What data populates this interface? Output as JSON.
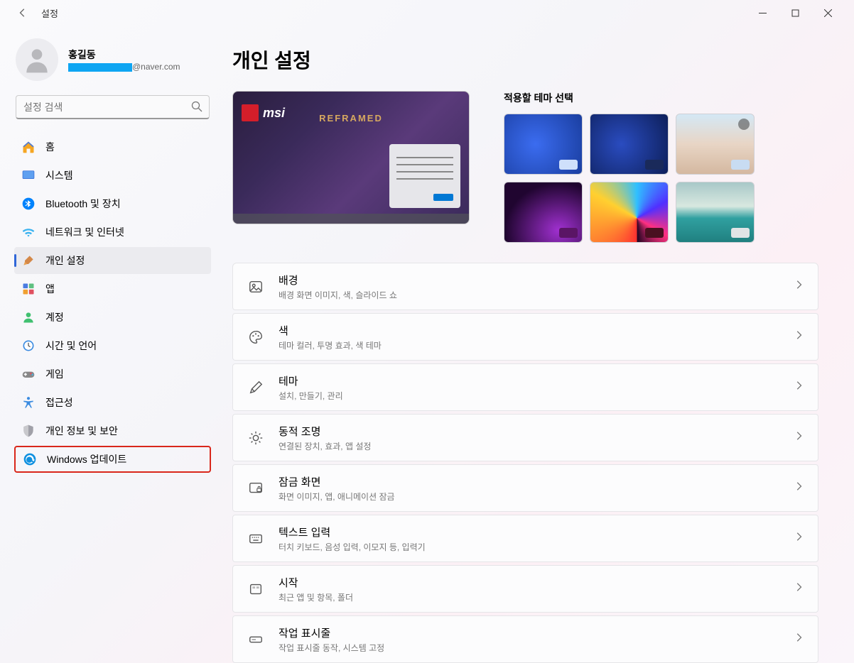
{
  "window": {
    "title": "설정"
  },
  "user": {
    "name": "홍길동",
    "email_domain": "@naver.com"
  },
  "search": {
    "placeholder": "설정 검색"
  },
  "nav": [
    {
      "key": "home",
      "label": "홈",
      "icon": "home"
    },
    {
      "key": "system",
      "label": "시스템",
      "icon": "system"
    },
    {
      "key": "bluetooth",
      "label": "Bluetooth 및 장치",
      "icon": "bluetooth"
    },
    {
      "key": "network",
      "label": "네트워크 및 인터넷",
      "icon": "wifi"
    },
    {
      "key": "personalization",
      "label": "개인 설정",
      "icon": "brush",
      "active": true
    },
    {
      "key": "apps",
      "label": "앱",
      "icon": "apps"
    },
    {
      "key": "accounts",
      "label": "계정",
      "icon": "user"
    },
    {
      "key": "time",
      "label": "시간 및 언어",
      "icon": "clock"
    },
    {
      "key": "gaming",
      "label": "게임",
      "icon": "gamepad"
    },
    {
      "key": "accessibility",
      "label": "접근성",
      "icon": "accessibility"
    },
    {
      "key": "privacy",
      "label": "개인 정보 및 보안",
      "icon": "shield"
    },
    {
      "key": "update",
      "label": "Windows 업데이트",
      "icon": "update",
      "highlighted": true
    }
  ],
  "page": {
    "title": "개인 설정"
  },
  "desktop_preview": {
    "brand": "msi",
    "caption": "REFRAMED"
  },
  "theme_picker": {
    "label": "적용할 테마 선택"
  },
  "settings_items": [
    {
      "key": "background",
      "title": "배경",
      "sub": "배경 화면 이미지, 색, 슬라이드 쇼",
      "icon": "image"
    },
    {
      "key": "colors",
      "title": "색",
      "sub": "테마 컬러, 투명 효과, 색 테마",
      "icon": "palette"
    },
    {
      "key": "themes",
      "title": "테마",
      "sub": "설치, 만들기, 관리",
      "icon": "pen"
    },
    {
      "key": "dynamic_lighting",
      "title": "동적 조명",
      "sub": "연결된 장치, 효과, 앱 설정",
      "icon": "light"
    },
    {
      "key": "lock_screen",
      "title": "잠금 화면",
      "sub": "화면 이미지, 앱, 애니메이션 잠금",
      "icon": "lock"
    },
    {
      "key": "text_input",
      "title": "텍스트 입력",
      "sub": "터치 키보드, 음성 입력, 이모지 등, 입력기",
      "icon": "keyboard"
    },
    {
      "key": "start",
      "title": "시작",
      "sub": "최근 앱 및 항목, 폴더",
      "icon": "start"
    },
    {
      "key": "taskbar",
      "title": "작업 표시줄",
      "sub": "작업 표시줄 동작, 시스템 고정",
      "icon": "taskbar"
    }
  ]
}
